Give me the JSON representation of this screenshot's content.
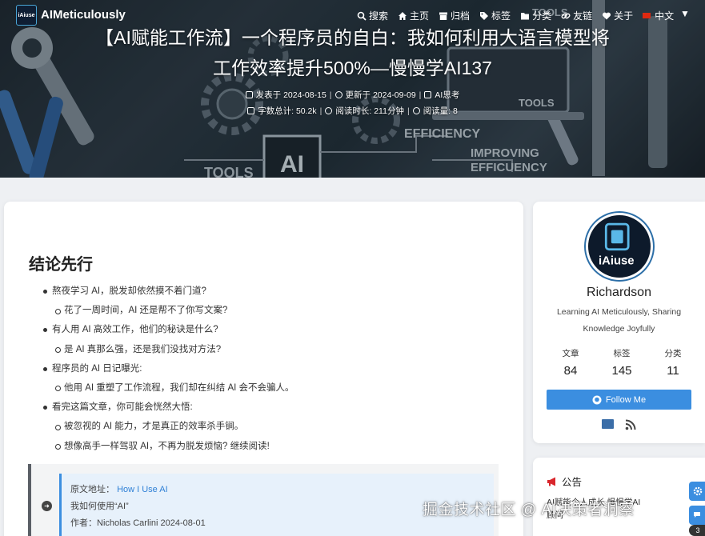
{
  "site": {
    "name": "AIMeticulously",
    "logo_text": "iAiuse"
  },
  "nav": {
    "items": [
      {
        "label": "搜索",
        "icon": "search-icon"
      },
      {
        "label": "主页",
        "icon": "home-icon"
      },
      {
        "label": "归档",
        "icon": "archive-icon"
      },
      {
        "label": "标签",
        "icon": "tags-icon"
      },
      {
        "label": "分类",
        "icon": "folder-icon"
      },
      {
        "label": "友链",
        "icon": "link-icon"
      },
      {
        "label": "关于",
        "icon": "heart-icon"
      },
      {
        "label": "中文",
        "icon": "flag-icon"
      }
    ],
    "chevron": "▼"
  },
  "post": {
    "title_line1": "【AI赋能工作流】一个程序员的自白：我如何利用大语言模型将",
    "title_line2": "工作效率提升500%—慢慢学AI137",
    "published": "发表于 2024-08-15",
    "updated": "更新于 2024-09-09",
    "category": "AI思考",
    "word_count": "字数总计: 50.2k",
    "read_time": "阅读时长: 211分钟",
    "views": "阅读量: 8",
    "sep": "|"
  },
  "article": {
    "heading": "结论先行",
    "items": [
      {
        "level": 1,
        "text": "熬夜学习 AI，脱发却依然摸不着门道?"
      },
      {
        "level": 2,
        "text": "花了一周时间，AI 还是帮不了你写文案?"
      },
      {
        "level": 1,
        "text": "有人用 AI 高效工作，他们的秘诀是什么?"
      },
      {
        "level": 2,
        "text": "是 AI 真那么强，还是我们没找对方法?"
      },
      {
        "level": 1,
        "text": "程序员的 AI 日记曝光:"
      },
      {
        "level": 2,
        "text": "他用 AI 重塑了工作流程，我们却在纠结 AI 会不会骗人。"
      },
      {
        "level": 1,
        "text": "看完这篇文章，你可能会恍然大悟:"
      },
      {
        "level": 2,
        "text": "被忽视的 AI 能力，才是真正的效率杀手锏。"
      },
      {
        "level": 2,
        "text": "想像高手一样驾驭 AI，不再为脱发烦恼? 继续阅读!"
      }
    ],
    "quote": {
      "source_label": "原文地址：",
      "source_link": "How I Use AI",
      "line2": "我如何使用“AI”",
      "line3": "作者：Nicholas Carlini 2024-08-01"
    }
  },
  "profile": {
    "avatar_text": "iAiuse",
    "name": "Richardson",
    "description": "Learning AI Meticulously, Sharing Knowledge Joyfully",
    "stats": [
      {
        "label": "文章",
        "value": "84"
      },
      {
        "label": "标签",
        "value": "145"
      },
      {
        "label": "分类",
        "value": "11"
      }
    ],
    "follow_label": "Follow Me"
  },
  "notice": {
    "title": "公告",
    "text": "AI赋能个人成长 慢慢学AI顾问"
  },
  "floating": {
    "badge": "3"
  },
  "watermark": "掘金技术社区 @ AI决策者洞察",
  "colors": {
    "accent": "#3b8ee0",
    "notice_icon": "#d9262c"
  }
}
